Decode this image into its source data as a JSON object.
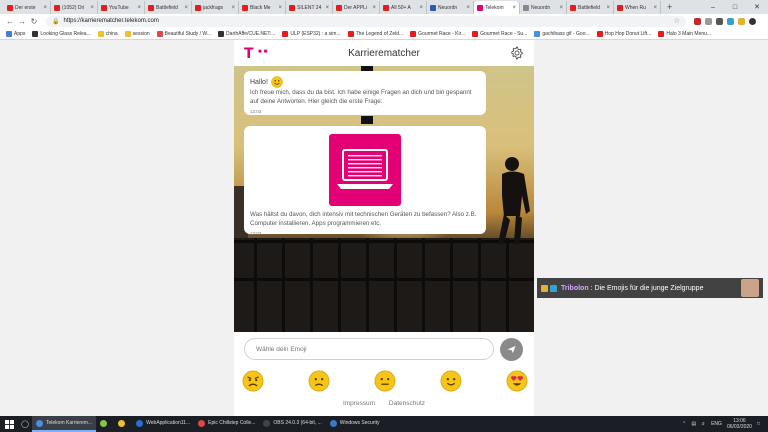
{
  "browser": {
    "tabs": [
      {
        "title": "Der erste",
        "color": "#e02020"
      },
      {
        "title": "(1052) Dri",
        "color": "#e02020"
      },
      {
        "title": "YouTube",
        "color": "#e02020"
      },
      {
        "title": "Battlefield",
        "color": "#e02020"
      },
      {
        "title": "jackfrags",
        "color": "#e02020"
      },
      {
        "title": "Black Me",
        "color": "#e02020"
      },
      {
        "title": "SILENT 24",
        "color": "#e02020"
      },
      {
        "title": "Der APPLi",
        "color": "#e02020"
      },
      {
        "title": "All 50+ A",
        "color": "#e02020"
      },
      {
        "title": "Neuordn",
        "color": "#2a5db0"
      },
      {
        "title": "Telekom",
        "color": "#e20074",
        "active": true
      },
      {
        "title": "Neuordn",
        "color": "#888888"
      },
      {
        "title": "Battlefield",
        "color": "#e02020"
      },
      {
        "title": "When Ru",
        "color": "#e02020"
      }
    ],
    "new_tab": "+",
    "url": "https://karrierematcher.telekom.com",
    "bookmarks": [
      {
        "label": "Apps",
        "color": "#4a7be0"
      },
      {
        "label": "Looking Glass Relea...",
        "color": "#333333"
      },
      {
        "label": "china",
        "color": "#f0c030"
      },
      {
        "label": "session",
        "color": "#f0c030"
      },
      {
        "label": "Beautiful Study / W...",
        "color": "#e04848"
      },
      {
        "label": "DarthAffe/CUE.NET:...",
        "color": "#333333"
      },
      {
        "label": "ULP (ESP32) : a sim...",
        "color": "#e02020"
      },
      {
        "label": "The Legend of Zeld...",
        "color": "#e02020"
      },
      {
        "label": "Gourmet Race - Kir...",
        "color": "#e02020"
      },
      {
        "label": "Gourmet Race - Su...",
        "color": "#e02020"
      },
      {
        "label": "gachibass gif - Goo...",
        "color": "#4a90e0"
      },
      {
        "label": "Hop Hop Donut Lift...",
        "color": "#e02020"
      },
      {
        "label": "Halo 3 Main Menu...",
        "color": "#e02020"
      }
    ]
  },
  "app": {
    "title": "Karrierematcher",
    "messages": [
      {
        "greeting": "Hallo!",
        "text": "Ich freue mich, dass du da bist. Ich habe einige Fragen an dich und bin gespannt auf deine Antworten. Hier gleich die erste Frage:",
        "time": "13:03"
      },
      {
        "text": "Was hältst du davon, dich intensiv mit technischen Geräten zu befassen? Also z.B. Computer installieren, Apps programmieren etc.",
        "time": "13:03"
      }
    ],
    "input_placeholder": "Wähle dein Emoji",
    "emojis": [
      "angry-face",
      "frowning-face",
      "neutral-face",
      "slightly-smiling-face",
      "heart-eyes-face"
    ],
    "footer": {
      "imprint": "Impressum",
      "privacy": "Datenschutz"
    }
  },
  "overlay": {
    "user": "Tribolon",
    "message": "Die Emojis für die junge Zielgruppe"
  },
  "taskbar": {
    "items": [
      {
        "label": "Telekom Karrierem...",
        "color": "#4a90e0",
        "active": true
      },
      {
        "label": "",
        "color": "#8bc34a"
      },
      {
        "label": "",
        "color": "#f0c030"
      },
      {
        "label": "WebApplication11...",
        "color": "#2a6fd0"
      },
      {
        "label": "Epic Chillstep Colle...",
        "color": "#e04848"
      },
      {
        "label": "OBS 24.0.3 (64-bit, ...",
        "color": "#444444"
      },
      {
        "label": "Windows Security",
        "color": "#3a78c8"
      }
    ],
    "language": "ENG",
    "time": "13:06",
    "date": "06/03/2020"
  },
  "colors": {
    "brand": "#e20074",
    "send_button": "#8a8a8a",
    "emoji_yellow": "#f5c518"
  }
}
